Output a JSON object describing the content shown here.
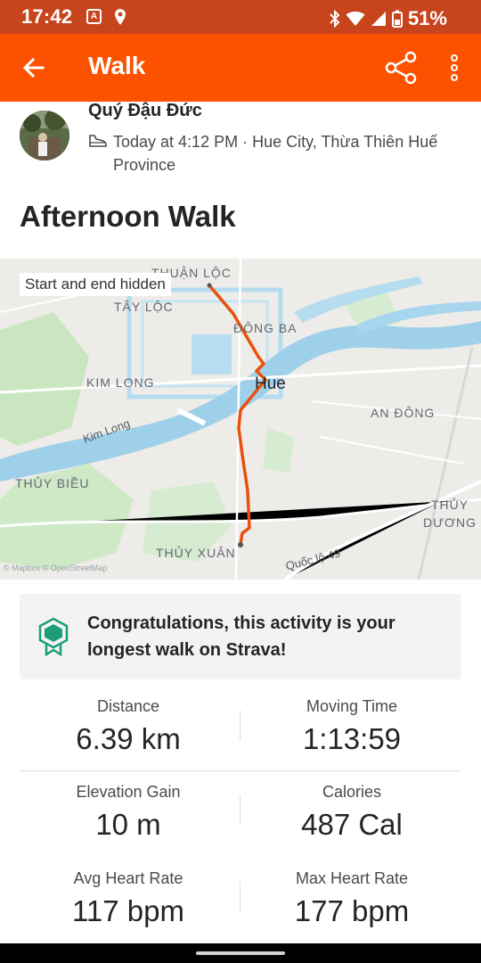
{
  "status_bar": {
    "time": "17:42",
    "notification_glyph": "A",
    "battery_percent": "51%"
  },
  "app_bar": {
    "title": "Walk",
    "back_icon": "arrow-back-icon",
    "share_icon": "share-icon",
    "more_icon": "more-vertical-icon"
  },
  "athlete": {
    "name": "Quý Đậu Đức",
    "meta": "Today at 4:12 PM · Hue City, Thừa Thiên Huế Province"
  },
  "activity": {
    "title": "Afternoon Walk"
  },
  "map": {
    "hidden_notice": "Start and end hidden",
    "city_label": "Hue",
    "districts": [
      "THUẬN LỘC",
      "TÂY LỘC",
      "ĐÔNG BA",
      "KIM LONG",
      "AN ĐÔNG",
      "THỦY BIỀU",
      "THỦY XUÂN",
      "THỦY DƯƠNG"
    ],
    "roads": [
      "Kim Long",
      "Quốc lộ 49"
    ],
    "attribution": "© Mapbox © OpenStreetMap",
    "route_color": "#e8500c"
  },
  "achievement": {
    "text": "Congratulations, this activity is your longest walk on Strava!",
    "icon": "achievement-badge-icon"
  },
  "stats": [
    {
      "label": "Distance",
      "value": "6.39 km"
    },
    {
      "label": "Moving Time",
      "value": "1:13:59"
    },
    {
      "label": "Elevation Gain",
      "value": "10 m"
    },
    {
      "label": "Calories",
      "value": "487 Cal"
    },
    {
      "label": "Avg Heart Rate",
      "value": "117 bpm"
    },
    {
      "label": "Max Heart Rate",
      "value": "177 bpm"
    }
  ],
  "colors": {
    "brand": "#fc5200",
    "status_bar": "#c7441c",
    "achievement_green": "#1b9e77"
  }
}
